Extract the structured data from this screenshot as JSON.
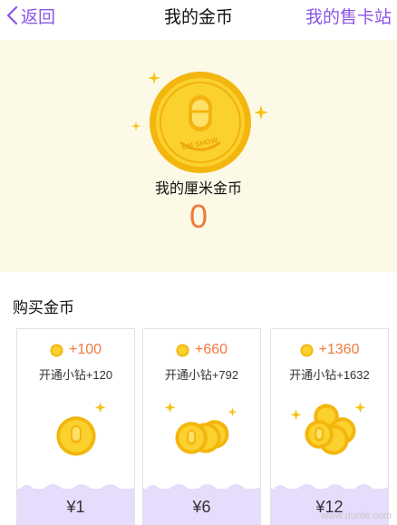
{
  "nav": {
    "back_label": "返回",
    "title": "我的金币",
    "right_label": "我的售卡站"
  },
  "hero": {
    "coin_icon": "cm-show-coin-icon",
    "label": "我的厘米金币",
    "value": "0"
  },
  "section": {
    "title": "购买金币"
  },
  "cards": [
    {
      "coins": "+100",
      "bonus": "开通小钻+120",
      "price": "¥1"
    },
    {
      "coins": "+660",
      "bonus": "开通小钻+792",
      "price": "¥6"
    },
    {
      "coins": "+1360",
      "bonus": "开通小钻+1632",
      "price": "¥12"
    }
  ],
  "watermark": {
    "text": "www.duote.com"
  },
  "colors": {
    "accent": "#8a55e8",
    "coin_orange": "#f07a3c",
    "hero_bg": "#fcf9e6",
    "price_bar": "#e6dcfb",
    "gold": "#f7c51c"
  }
}
